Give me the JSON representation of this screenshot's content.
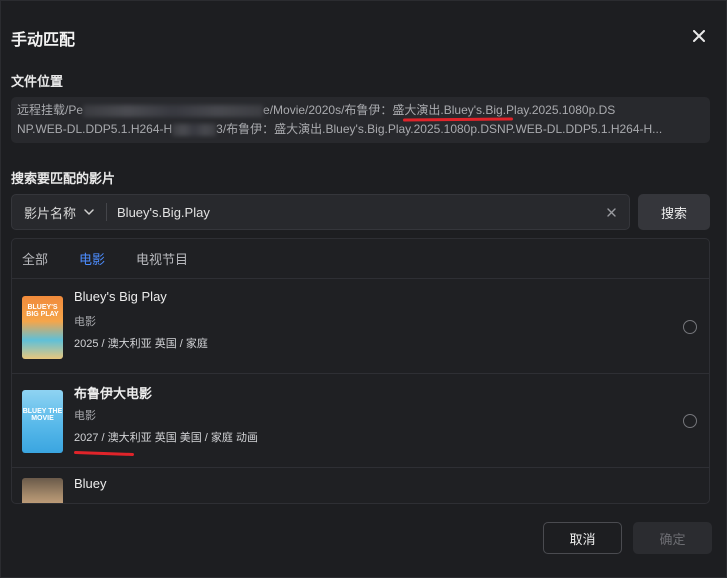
{
  "dialog": {
    "title": "手动匹配",
    "close_icon": "close-icon"
  },
  "file_location": {
    "label": "文件位置",
    "line1_prefix": "远程挂载/Pe",
    "line1_suffix": "e/Movie/2020s/布鲁伊：盛大演出.Bluey's.Big.Play.2025.1080p.DS",
    "line2_prefix": "NP.WEB-DL.DDP5.1.H264-H",
    "line2_suffix": "3/布鲁伊：盛大演出.Bluey's.Big.Play.2025.1080p.DSNP.WEB-DL.DDP5.1.H264-H...",
    "highlight_color": "#e0242a"
  },
  "search": {
    "label": "搜索要匹配的影片",
    "type_selected": "影片名称",
    "query": "Bluey's.Big.Play",
    "button_label": "搜索",
    "clear_icon": "close-icon",
    "dropdown_icon": "chevron-down-icon"
  },
  "tabs": [
    {
      "label": "全部",
      "active": false
    },
    {
      "label": "电影",
      "active": true
    },
    {
      "label": "电视节目",
      "active": false
    }
  ],
  "accent_color": "#4c8dff",
  "results": [
    {
      "poster_text": "BLUEY'S BIG PLAY",
      "name": "Bluey's Big Play",
      "type": "电影",
      "meta": "2025 / 澳大利亚 英国 / 家庭"
    },
    {
      "poster_text": "BLUEY THE MOVIE",
      "name": "布鲁伊大电影",
      "type": "电影",
      "meta": "2027 / 澳大利亚 英国 美国 / 家庭 动画"
    },
    {
      "name": "Bluey"
    }
  ],
  "footer": {
    "cancel_label": "取消",
    "confirm_label": "确定"
  }
}
